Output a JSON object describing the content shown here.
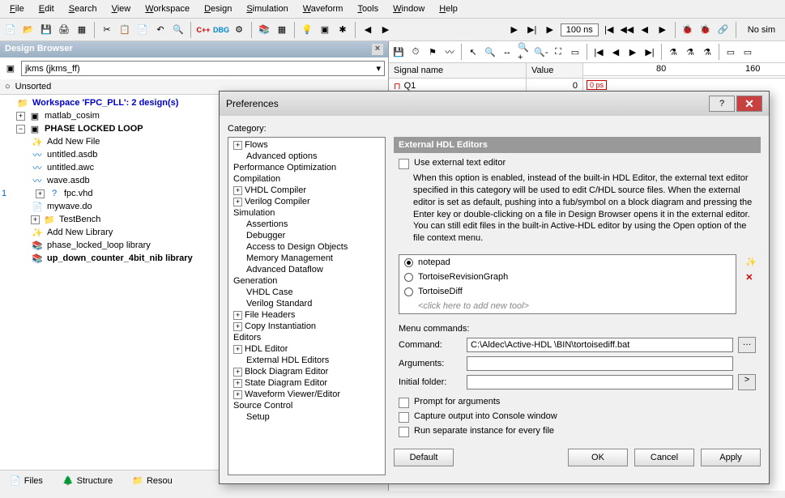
{
  "menu": [
    "File",
    "Edit",
    "Search",
    "View",
    "Workspace",
    "Design",
    "Simulation",
    "Waveform",
    "Tools",
    "Window",
    "Help"
  ],
  "toolbar2": {
    "time": "100 ns",
    "status": "No sim"
  },
  "designBrowser": {
    "title": "Design Browser",
    "combo": "jkms (jkms_ff)",
    "sortHeader": "Unsorted",
    "nodes": {
      "ws": "Workspace 'FPC_PLL': 2 design(s)",
      "matlab": "matlab_cosim",
      "pll": "PHASE LOCKED LOOP",
      "addFile": "Add New File",
      "u_asdb": "untitled.asdb",
      "u_awc": "untitled.awc",
      "wave": "wave.asdb",
      "fpc": "fpc.vhd",
      "mywave": "mywave.do",
      "tb": "TestBench",
      "addLib": "Add New Library",
      "pllLib": "phase_locked_loop library",
      "updown": "up_down_counter_4bit_nib library",
      "rowNum": "1"
    },
    "tabs": [
      "Files",
      "Structure",
      "Resou"
    ]
  },
  "waveform": {
    "cols": {
      "signal": "Signal name",
      "value": "Value"
    },
    "signal": "Q1",
    "val": "0",
    "ticks": [
      "80",
      "160"
    ],
    "cursor": "0 ps"
  },
  "prefs": {
    "title": "Preferences",
    "catLabel": "Category:",
    "categories": {
      "flows": "Flows",
      "advOpt": "Advanced options",
      "perfOpt": "Performance Optimization",
      "compilation": "Compilation",
      "vhdlC": "VHDL Compiler",
      "verilogC": "Verilog Compiler",
      "simulation": "Simulation",
      "assertions": "Assertions",
      "debugger": "Debugger",
      "access": "Access to Design Objects",
      "memmgmt": "Memory Management",
      "advdf": "Advanced Dataflow",
      "generation": "Generation",
      "vhdlCase": "VHDL Case",
      "verilogStd": "Verilog Standard",
      "fileHdr": "File Headers",
      "copyInst": "Copy Instantiation",
      "editors": "Editors",
      "hdlEd": "HDL Editor",
      "extHdl": "External HDL Editors",
      "blockEd": "Block Diagram Editor",
      "stateEd": "State Diagram Editor",
      "waveEd": "Waveform Viewer/Editor",
      "srcCtrl": "Source Control",
      "setup": "Setup"
    },
    "section": "External HDL Editors",
    "useExt": "Use external text editor",
    "desc": "When this option is enabled, instead of the built-in HDL Editor, the external text editor specified in this category will be used to edit C/HDL source files. When the external editor is set as default, pushing into a fub/symbol on a block diagram and pressing the Enter key or double-clicking on a file in Design Browser opens it in the external editor. You can still edit files in the built-in Active-HDL editor by using the Open option of the file context menu.",
    "tools": [
      "notepad",
      "TortoiseRevisionGraph",
      "TortoiseDiff"
    ],
    "selectedTool": 0,
    "addHint": "<click here to add new tool>",
    "menuCmds": "Menu commands:",
    "form": {
      "cmdLabel": "Command:",
      "cmd": "C:\\Aldec\\Active-HDL \\BIN\\tortoisediff.bat",
      "argsLabel": "Arguments:",
      "args": "",
      "folderLabel": "Initial folder:",
      "folder": ""
    },
    "opts": {
      "prompt": "Prompt for arguments",
      "capture": "Capture output into Console window",
      "runSep": "Run separate instance for every file"
    },
    "buttons": {
      "default": "Default",
      "ok": "OK",
      "cancel": "Cancel",
      "apply": "Apply"
    }
  }
}
